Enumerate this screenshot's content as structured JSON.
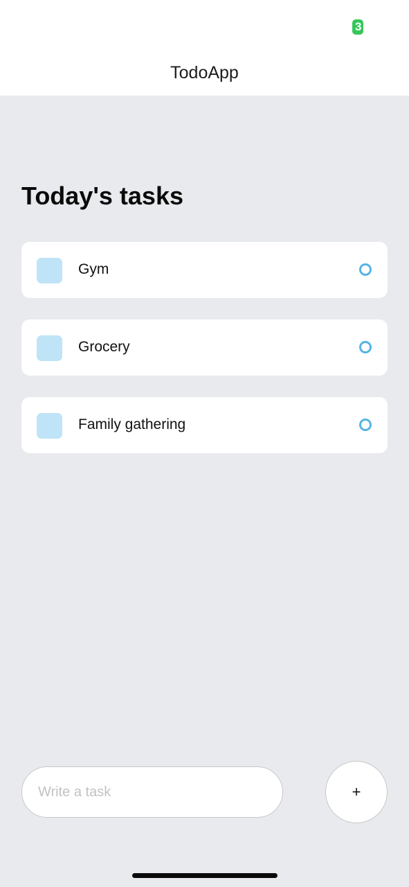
{
  "status_bar": {
    "battery_text": "3",
    "battery_color": "#35c759"
  },
  "header": {
    "title": "TodoApp"
  },
  "main": {
    "section_title": "Today's tasks",
    "tasks": [
      {
        "label": "Gym"
      },
      {
        "label": "Grocery"
      },
      {
        "label": "Family gathering"
      }
    ]
  },
  "composer": {
    "input_placeholder": "Write a task",
    "input_value": "",
    "add_label": "+"
  },
  "colors": {
    "background": "#e8eaed",
    "card": "#ffffff",
    "task_square": "#bfe3f7",
    "task_circle": "#55b4e4"
  },
  "icons": {
    "task_square": "square-icon",
    "task_circle": "circle-icon"
  }
}
